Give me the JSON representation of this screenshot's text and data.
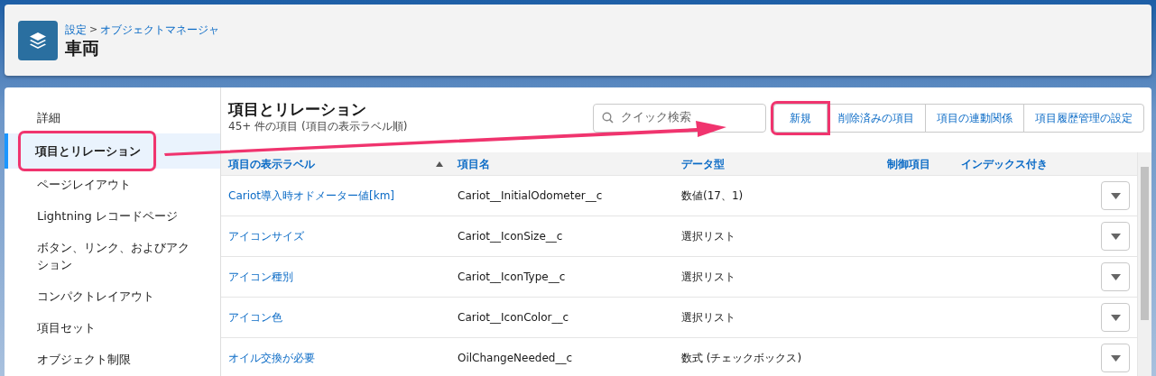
{
  "header": {
    "breadcrumb": [
      {
        "label": "設定"
      },
      {
        "label": "オブジェクトマネージャ"
      }
    ],
    "separator": ">",
    "title": "車両"
  },
  "sidebar": {
    "items": [
      {
        "label": "詳細",
        "selected": false,
        "highlighted": false
      },
      {
        "label": "項目とリレーション",
        "selected": true,
        "highlighted": true
      },
      {
        "label": "ページレイアウト",
        "selected": false,
        "highlighted": false
      },
      {
        "label": "Lightning レコードページ",
        "selected": false,
        "highlighted": false
      },
      {
        "label": "ボタン、リンク、およびアクション",
        "selected": false,
        "highlighted": false
      },
      {
        "label": "コンパクトレイアウト",
        "selected": false,
        "highlighted": false
      },
      {
        "label": "項目セット",
        "selected": false,
        "highlighted": false
      },
      {
        "label": "オブジェクト制限",
        "selected": false,
        "highlighted": false
      }
    ]
  },
  "section": {
    "title": "項目とリレーション",
    "subtitle": "45+ 件の項目 (項目の表示ラベル順)"
  },
  "search": {
    "placeholder": "クイック検索"
  },
  "buttons": [
    {
      "label": "新規",
      "highlighted": true
    },
    {
      "label": "削除済みの項目",
      "highlighted": false
    },
    {
      "label": "項目の連動関係",
      "highlighted": false
    },
    {
      "label": "項目履歴管理の設定",
      "highlighted": false
    }
  ],
  "table": {
    "columns": [
      {
        "label": "項目の表示ラベル",
        "sorted": true
      },
      {
        "label": "項目名",
        "sorted": false
      },
      {
        "label": "データ型",
        "sorted": false
      },
      {
        "label": "制御項目",
        "sorted": false
      },
      {
        "label": "インデックス付き",
        "sorted": false
      }
    ],
    "rows": [
      {
        "label": "Cariot導入時オドメーター値[km]",
        "name": "Cariot__InitialOdometer__c",
        "type": "数値(17、1)"
      },
      {
        "label": "アイコンサイズ",
        "name": "Cariot__IconSize__c",
        "type": "選択リスト"
      },
      {
        "label": "アイコン種別",
        "name": "Cariot__IconType__c",
        "type": "選択リスト"
      },
      {
        "label": "アイコン色",
        "name": "Cariot__IconColor__c",
        "type": "選択リスト"
      },
      {
        "label": "オイル交換が必要",
        "name": "OilChangeNeeded__c",
        "type": "数式 (チェックボックス)"
      }
    ]
  }
}
